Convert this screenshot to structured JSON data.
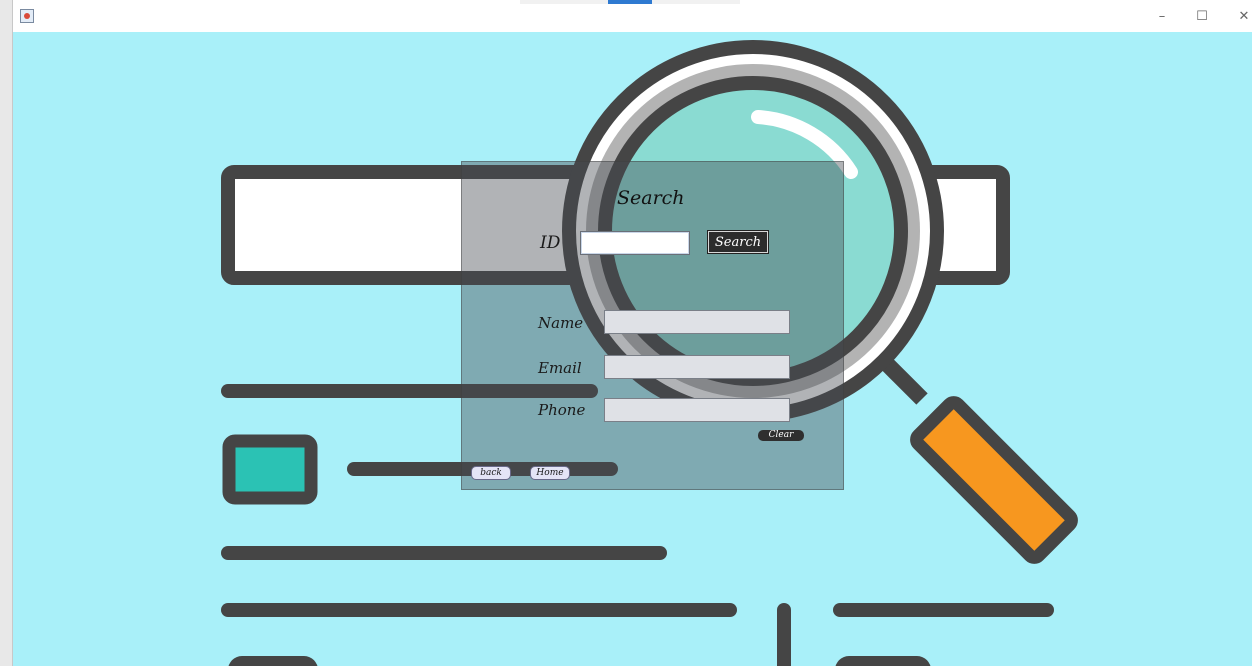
{
  "window": {
    "controls": {
      "minimize": "–",
      "maximize": "☐",
      "close": "✕"
    },
    "icon": "java-app-icon"
  },
  "form": {
    "title": "Search",
    "id_label": "ID",
    "id_value": "",
    "search_button": "Search",
    "name_label": "Name",
    "name_value": "",
    "email_label": "Email",
    "email_value": "",
    "phone_label": "Phone",
    "phone_value": "",
    "clear_button": "Clear",
    "back_button": "back",
    "home_button": "Home"
  },
  "colors": {
    "background": "#a9f0f9",
    "dark_stroke": "#454545",
    "lens": "#8adbd2",
    "handle": "#f7971f",
    "teal_block": "#2bc2b4"
  }
}
